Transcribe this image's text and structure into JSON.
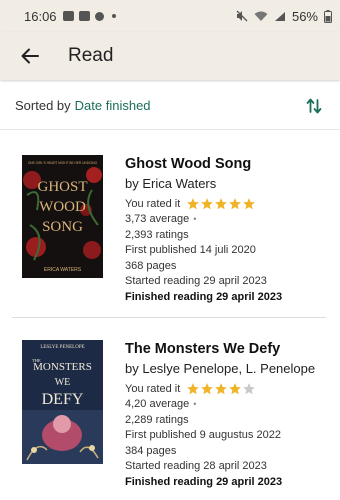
{
  "status_bar": {
    "time": "16:06",
    "battery": "56%"
  },
  "app_bar": {
    "title": "Read"
  },
  "sort_bar": {
    "label": "Sorted by",
    "value": "Date finished"
  },
  "colors": {
    "accent": "#1b6e5b",
    "star_filled": "#f0b429",
    "star_empty": "#c9c9c9",
    "bar_bg": "#f1ede5"
  },
  "books": [
    {
      "title": "Ghost Wood Song",
      "author": "by Erica Waters",
      "rated_label": "You rated it",
      "user_rating": 5,
      "average": "3,73 average",
      "ratings": "2,393 ratings",
      "first_published": "First published 14 juli 2020",
      "pages": "368 pages",
      "started": "Started reading 29 april 2023",
      "finished": "Finished reading 29 april 2023",
      "cover": {
        "top_text": "ONE GIRL'S HEART MIGHT BE HER UNDOING",
        "title_lines": [
          "GHOST",
          "WOOD",
          "SONG"
        ],
        "author": "ERICA WATERS"
      }
    },
    {
      "title": "The Monsters We Defy",
      "author": "by Leslye Penelope, L. Penelope",
      "rated_label": "You rated it",
      "user_rating": 4,
      "average": "4,20 average",
      "ratings": "2,289 ratings",
      "first_published": "First published 9 augustus 2022",
      "pages": "384 pages",
      "started": "Started reading 28 april 2023",
      "finished": "Finished reading 29 april 2023",
      "cover": {
        "author": "LESLYE PENELOPE",
        "title_lines": [
          "THE",
          "MONSTERS",
          "WE",
          "DEFY"
        ]
      }
    }
  ]
}
